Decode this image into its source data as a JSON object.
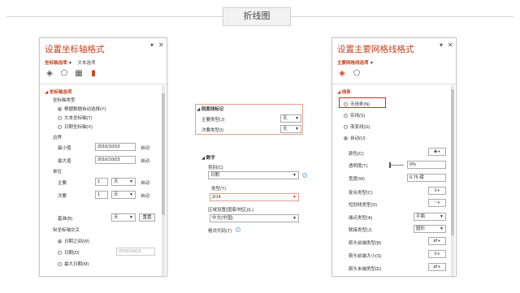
{
  "page_title": "折线图",
  "left_pane": {
    "title": "设置坐标轴格式",
    "tab_active": "坐标轴选项",
    "tab_other": "文本选项",
    "section": "坐标轴选项",
    "axis_type_label": "坐标轴类型",
    "axis_type_options": [
      "根据数据自动选择(Y)",
      "文本坐标轴(T)",
      "日期坐标轴(X)"
    ],
    "bounds_label": "边界",
    "min_label": "最小值",
    "min_value": "2016/10/10",
    "min_auto": "自动",
    "max_label": "最大值",
    "max_value": "2016/10/23",
    "max_auto": "自动",
    "units_label": "单位",
    "major_label": "主要",
    "major_value": "1",
    "major_unit": "天",
    "major_auto": "自动",
    "minor_label": "次要",
    "minor_value": "1",
    "minor_unit": "天",
    "minor_auto": "自动",
    "base_label": "基准(B)",
    "base_unit": "天",
    "base_reset": "重置",
    "cross_label": "纵坐标轴交叉",
    "cross_options": [
      "日期之间(W)",
      "日期(D)",
      "最大日期(M)"
    ],
    "cross_date_value": "2016/10/10"
  },
  "middle": {
    "ticks_header": "刻度线标记",
    "major_type_label": "主要类型(J)",
    "major_type_value": "无",
    "minor_type_label": "次要类型(I)",
    "minor_type_value": "无",
    "number_header": "数字",
    "category_label": "类别(C)",
    "category_value": "日期",
    "type_label": "类型(T)",
    "type_value": "3/14",
    "region_label": "区域设置(国家/地区)(L)",
    "region_value": "中文(中国)",
    "format_code_label": "格式代码(T)"
  },
  "right_pane": {
    "title": "设置主要网格线格式",
    "tab_active": "主要网格线选项",
    "section": "线条",
    "line_options": [
      "无线条(N)",
      "实线(S)",
      "渐变线(G)",
      "自动(U)"
    ],
    "color_label": "颜色(C)",
    "transparency_label": "透明度(T)",
    "transparency_value": "0%",
    "width_label": "宽度(W)",
    "width_value": "0.75 磅",
    "compound_label": "复合类型(C)",
    "dash_label": "短划线类型(D)",
    "cap_label": "端点类型(A)",
    "cap_value": "平面",
    "join_label": "联接类型(J)",
    "join_value": "圆形",
    "begin_arrow_type_label": "箭头前端类型(B)",
    "begin_arrow_size_label": "箭头前端大小(S)",
    "end_arrow_type_label": "箭头末端类型(E)"
  },
  "colors": {
    "accent": "#c5401b",
    "highlight": "#d42626"
  }
}
